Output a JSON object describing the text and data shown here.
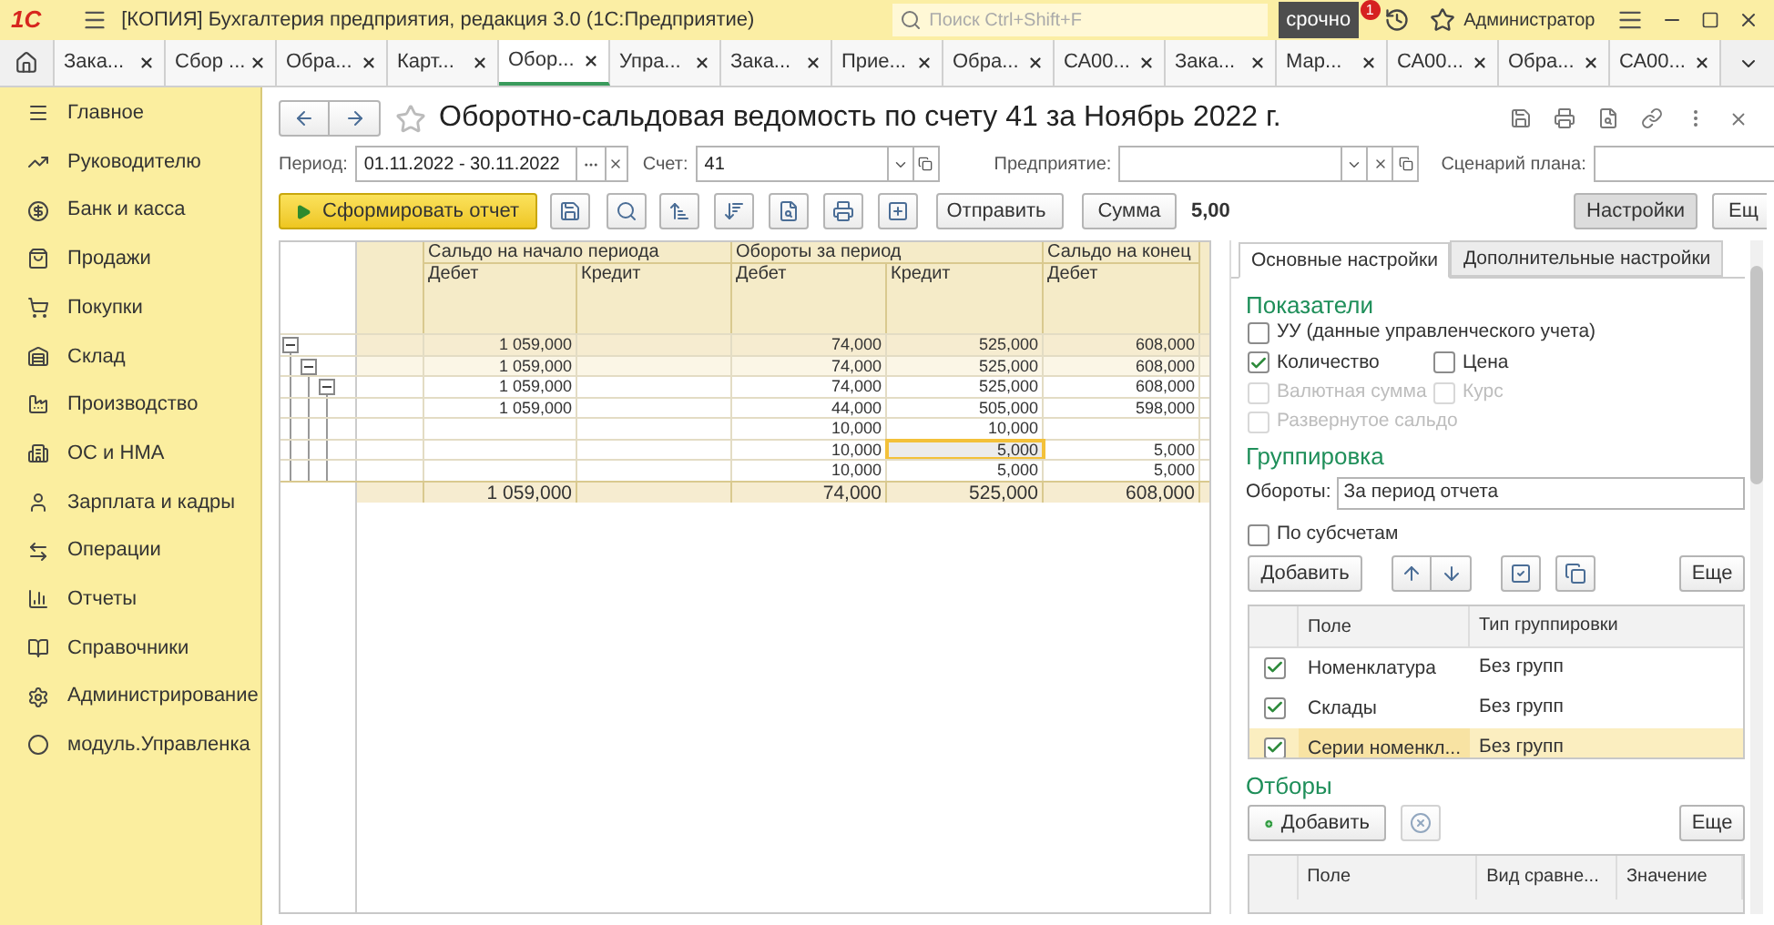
{
  "app": {
    "logo": "1С",
    "title": "[КОПИЯ] Бухгалтерия предприятия, редакция 3.0  (1С:Предприятие)",
    "search_placeholder": "Поиск Ctrl+Shift+F",
    "urgent_badge": "срочно",
    "notification_count": "1",
    "user": "Администратор"
  },
  "tabs": [
    {
      "label": "Зака...",
      "selected": false
    },
    {
      "label": "Сбор ...",
      "selected": false
    },
    {
      "label": "Обра...",
      "selected": false
    },
    {
      "label": "Карт...",
      "selected": false
    },
    {
      "label": "Обор...",
      "selected": true
    },
    {
      "label": "Упра...",
      "selected": false
    },
    {
      "label": "Зака...",
      "selected": false
    },
    {
      "label": "Прие...",
      "selected": false
    },
    {
      "label": "Обра...",
      "selected": false
    },
    {
      "label": "СА00...",
      "selected": false
    },
    {
      "label": "Зака...",
      "selected": false
    },
    {
      "label": "Мар...",
      "selected": false
    },
    {
      "label": "СА00...",
      "selected": false
    },
    {
      "label": "Обра...",
      "selected": false
    },
    {
      "label": "СА00...",
      "selected": false
    }
  ],
  "sidebar": {
    "items": [
      "Главное",
      "Руководителю",
      "Банк и касса",
      "Продажи",
      "Покупки",
      "Склад",
      "Производство",
      "ОС и НМА",
      "Зарплата и кадры",
      "Операции",
      "Отчеты",
      "Справочники",
      "Администрирование",
      "модуль.Управленка"
    ]
  },
  "report": {
    "title": "Оборотно-сальдовая ведомость по счету 41 за Ноябрь 2022 г.",
    "favorite": false,
    "filters": [
      {
        "label": "Период:",
        "value": "01.11.2022 - 30.11.2022"
      },
      {
        "label": "Счет:",
        "value": "41"
      },
      {
        "label": "Предприятие:"
      },
      {
        "label": "Сценарий плана:"
      }
    ],
    "generate_button": "Сформировать отчет",
    "send_button": "Отправить",
    "sum_button": "Сумма",
    "sum_value": "5,00",
    "settings_button": "Настройки",
    "settings_pressed": true,
    "more_button": "Ещ"
  },
  "table": {
    "groups": [
      {
        "label": "Сальдо на начало периода",
        "columns": [
          "Дебет",
          "Кредит"
        ]
      },
      {
        "label": "Обороты за период",
        "columns": [
          "Дебет",
          "Кредит"
        ]
      },
      {
        "label": "Сальдо на конец",
        "columns": [
          "Дебет"
        ]
      }
    ],
    "rows": [
      {
        "expanded": true,
        "cells": [
          {
            "text": "1 059,000",
            "selected": false
          },
          {
            "selected": false
          },
          {
            "text": "74,000",
            "selected": false
          },
          {
            "text": "525,000",
            "selected": false
          },
          {
            "text": "608,000",
            "selected": false
          }
        ],
        "children": [
          {
            "expanded": true,
            "cells": [
              {
                "text": "1 059,000",
                "selected": false
              },
              {
                "selected": false
              },
              {
                "text": "74,000",
                "selected": false
              },
              {
                "text": "525,000",
                "selected": false
              },
              {
                "text": "608,000",
                "selected": false
              }
            ],
            "children": [
              {
                "expanded": true,
                "cells": [
                  {
                    "text": "1 059,000",
                    "selected": false
                  },
                  {
                    "selected": false
                  },
                  {
                    "text": "74,000",
                    "selected": false
                  },
                  {
                    "text": "525,000",
                    "selected": false
                  },
                  {
                    "text": "608,000",
                    "selected": false
                  }
                ],
                "children": [
                  {
                    "cells": [
                      {
                        "text": "1 059,000",
                        "selected": false
                      },
                      {
                        "selected": false
                      },
                      {
                        "text": "44,000",
                        "selected": false
                      },
                      {
                        "text": "505,000",
                        "selected": false
                      },
                      {
                        "text": "598,000",
                        "selected": false
                      }
                    ]
                  },
                  {
                    "cells": [
                      {
                        "selected": false
                      },
                      {
                        "selected": false
                      },
                      {
                        "text": "10,000",
                        "selected": false
                      },
                      {
                        "text": "10,000",
                        "selected": false
                      },
                      {
                        "selected": false
                      }
                    ]
                  },
                  {
                    "cells": [
                      {
                        "selected": false
                      },
                      {
                        "selected": false
                      },
                      {
                        "text": "10,000",
                        "selected": false
                      },
                      {
                        "text": "5,000",
                        "selected": true
                      },
                      {
                        "text": "5,000",
                        "selected": false
                      }
                    ]
                  },
                  {
                    "cells": [
                      {
                        "selected": false
                      },
                      {
                        "selected": false
                      },
                      {
                        "text": "10,000",
                        "selected": false
                      },
                      {
                        "text": "5,000",
                        "selected": false
                      },
                      {
                        "text": "5,000",
                        "selected": false
                      }
                    ]
                  }
                ]
              }
            ]
          }
        ]
      }
    ],
    "totals": [
      {
        "text": "1 059,000",
        "selected": false
      },
      {
        "selected": false
      },
      {
        "text": "74,000",
        "selected": false
      },
      {
        "text": "525,000",
        "selected": false
      },
      {
        "text": "608,000",
        "selected": false
      }
    ]
  },
  "settings": {
    "tabs": [
      {
        "label": "Основные настройки",
        "selected": true
      },
      {
        "label": "Дополнительные настройки",
        "selected": false
      }
    ],
    "indicators_title": "Показатели",
    "indicator_rows": [
      [
        {
          "label": "УУ (данные управленческого учета)",
          "checked": false,
          "disabled": false
        }
      ],
      [
        {
          "label": "Количество",
          "checked": true,
          "disabled": false
        },
        {
          "label": "Цена",
          "checked": false,
          "disabled": false
        }
      ],
      [
        {
          "label": "Валютная сумма",
          "checked": false,
          "disabled": true
        },
        {
          "label": "Курс",
          "checked": false,
          "disabled": true
        }
      ],
      [
        {
          "label": "Развернутое сальдо",
          "checked": false,
          "disabled": true
        }
      ]
    ],
    "grouping_title": "Группировка",
    "turnover": {
      "label": "Обороты:",
      "value": "За период отчета"
    },
    "subaccounts": {
      "label": "По субсчетам",
      "checked": false
    },
    "grouping_add": "Добавить",
    "grouping_more": "Еще",
    "grouping_columns": [
      "Поле",
      "Тип группировки"
    ],
    "grouping_rows": [
      {
        "field": "Номенклатура",
        "type": "Без групп",
        "checked": true,
        "selected": false
      },
      {
        "field": "Склады",
        "type": "Без групп",
        "checked": true,
        "selected": false
      },
      {
        "field": "Серии номенкл...",
        "type": "Без групп",
        "checked": true,
        "selected": true
      }
    ],
    "filters_title": "Отборы",
    "filters_add": "Добавить",
    "filters_more": "Еще",
    "filter_columns": [
      "Поле",
      "Вид сравне...",
      "Значение"
    ]
  }
}
